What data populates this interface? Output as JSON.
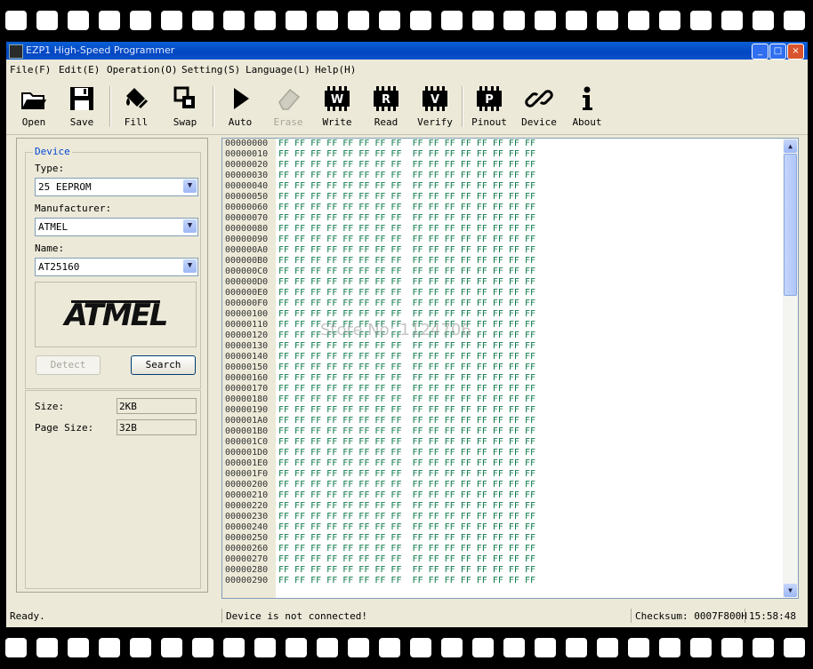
{
  "window": {
    "title": "EZP1 High-Speed Programmer",
    "min": "_",
    "max": "□",
    "close": "×"
  },
  "menu": [
    "File(F)",
    "Edit(E)",
    "Operation(O)",
    "Setting(S)",
    "Language(L)",
    "Help(H)"
  ],
  "toolbar": [
    {
      "icon": "folder-open-icon",
      "label": "Open"
    },
    {
      "icon": "floppy-save-icon",
      "label": "Save"
    },
    {
      "icon": "fill-bucket-icon",
      "label": "Fill"
    },
    {
      "icon": "swap-icon",
      "label": "Swap"
    },
    {
      "icon": "play-icon",
      "label": "Auto"
    },
    {
      "icon": "eraser-icon",
      "label": "Erase",
      "disabled": true
    },
    {
      "icon": "chip-w-icon",
      "label": "Write",
      "chip": "W"
    },
    {
      "icon": "chip-r-icon",
      "label": "Read",
      "chip": "R"
    },
    {
      "icon": "chip-v-icon",
      "label": "Verify",
      "chip": "V"
    },
    {
      "icon": "chip-p-icon",
      "label": "Pinout",
      "chip": "P"
    },
    {
      "icon": "link-icon",
      "label": "Device"
    },
    {
      "icon": "info-icon",
      "label": "About"
    }
  ],
  "device": {
    "group_label": "Device",
    "type_label": "Type:",
    "type_value": "25 EEPROM",
    "manufacturer_label": "Manufacturer:",
    "manufacturer_value": "ATMEL",
    "name_label": "Name:",
    "name_value": "AT25160",
    "logo_text": "ATMEL",
    "detect_label": "Detect",
    "search_label": "Search"
  },
  "info": {
    "size_label": "Size:",
    "size_value": "2KB",
    "page_size_label": "Page Size:",
    "page_size_value": "32B"
  },
  "hex": {
    "rows": [
      "00000000",
      "00000010",
      "00000020",
      "00000030",
      "00000040",
      "00000050",
      "00000060",
      "00000070",
      "00000080",
      "00000090",
      "000000A0",
      "000000B0",
      "000000C0",
      "000000D0",
      "000000E0",
      "000000F0",
      "00000100",
      "00000110",
      "00000120",
      "00000130",
      "00000140",
      "00000150",
      "00000160",
      "00000170",
      "00000180",
      "00000190",
      "000001A0",
      "000001B0",
      "000001C0",
      "000001D0",
      "000001E0",
      "000001F0",
      "00000200",
      "00000210",
      "00000220",
      "00000230",
      "00000240",
      "00000250",
      "00000260",
      "00000270",
      "00000280",
      "00000290"
    ],
    "byte_line": "FF FF FF FF FF FF FF FF  FF FF FF FF FF FF FF FF",
    "watermark": "Store No: 1124706"
  },
  "status": {
    "ready": "Ready.",
    "connection": "Device is not connected!",
    "checksum": "Checksum: 0007F800H",
    "time": "15:58:48"
  }
}
